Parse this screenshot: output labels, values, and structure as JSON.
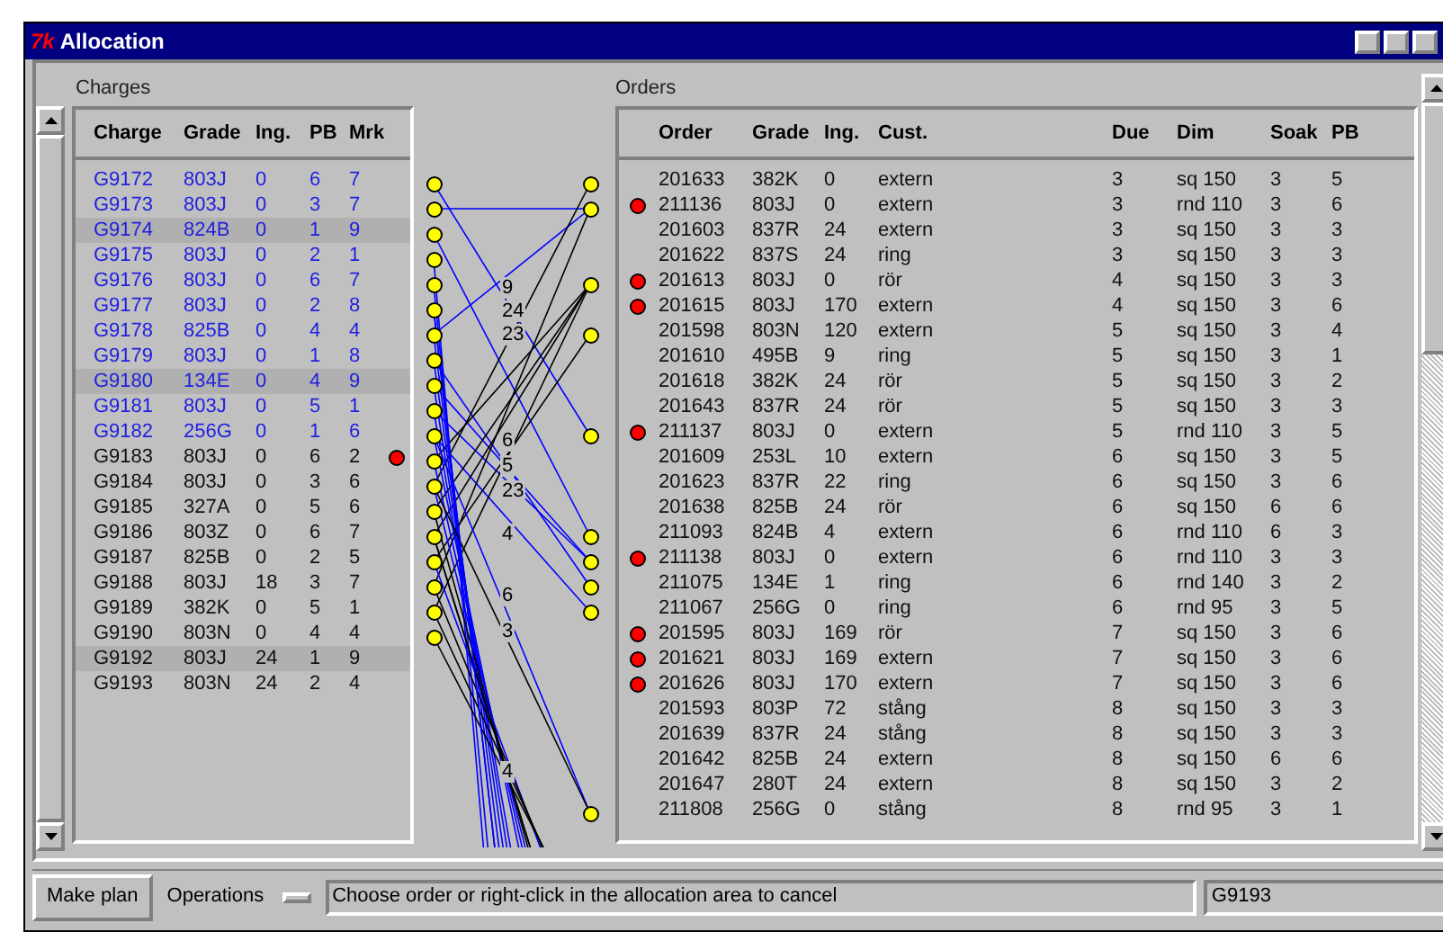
{
  "window": {
    "title": "Allocation",
    "logo": "7k"
  },
  "charges": {
    "title": "Charges",
    "columns": [
      "Charge",
      "Grade",
      "Ing.",
      "PB",
      "Mrk"
    ],
    "rows": [
      {
        "cells": [
          "G9172",
          "803J",
          "0",
          "6",
          "7"
        ],
        "planned": true,
        "highlighted": false,
        "flagged": false,
        "allocated": true
      },
      {
        "cells": [
          "G9173",
          "803J",
          "0",
          "3",
          "7"
        ],
        "planned": true,
        "highlighted": false,
        "flagged": false,
        "allocated": true
      },
      {
        "cells": [
          "G9174",
          "824B",
          "0",
          "1",
          "9"
        ],
        "planned": true,
        "highlighted": true,
        "flagged": false,
        "allocated": true
      },
      {
        "cells": [
          "G9175",
          "803J",
          "0",
          "2",
          "1"
        ],
        "planned": true,
        "highlighted": false,
        "flagged": false,
        "allocated": true
      },
      {
        "cells": [
          "G9176",
          "803J",
          "0",
          "6",
          "7"
        ],
        "planned": true,
        "highlighted": false,
        "flagged": false,
        "allocated": true
      },
      {
        "cells": [
          "G9177",
          "803J",
          "0",
          "2",
          "8"
        ],
        "planned": true,
        "highlighted": false,
        "flagged": false,
        "allocated": true
      },
      {
        "cells": [
          "G9178",
          "825B",
          "0",
          "4",
          "4"
        ],
        "planned": true,
        "highlighted": false,
        "flagged": false,
        "allocated": true
      },
      {
        "cells": [
          "G9179",
          "803J",
          "0",
          "1",
          "8"
        ],
        "planned": true,
        "highlighted": false,
        "flagged": false,
        "allocated": true
      },
      {
        "cells": [
          "G9180",
          "134E",
          "0",
          "4",
          "9"
        ],
        "planned": true,
        "highlighted": true,
        "flagged": false,
        "allocated": true
      },
      {
        "cells": [
          "G9181",
          "803J",
          "0",
          "5",
          "1"
        ],
        "planned": true,
        "highlighted": false,
        "flagged": false,
        "allocated": true
      },
      {
        "cells": [
          "G9182",
          "256G",
          "0",
          "1",
          "6"
        ],
        "planned": true,
        "highlighted": false,
        "flagged": false,
        "allocated": true
      },
      {
        "cells": [
          "G9183",
          "803J",
          "0",
          "6",
          "2"
        ],
        "planned": false,
        "highlighted": false,
        "flagged": true,
        "allocated": true
      },
      {
        "cells": [
          "G9184",
          "803J",
          "0",
          "3",
          "6"
        ],
        "planned": false,
        "highlighted": false,
        "flagged": false,
        "allocated": true
      },
      {
        "cells": [
          "G9185",
          "327A",
          "0",
          "5",
          "6"
        ],
        "planned": false,
        "highlighted": false,
        "flagged": false,
        "allocated": true
      },
      {
        "cells": [
          "G9186",
          "803Z",
          "0",
          "6",
          "7"
        ],
        "planned": false,
        "highlighted": false,
        "flagged": false,
        "allocated": true
      },
      {
        "cells": [
          "G9187",
          "825B",
          "0",
          "2",
          "5"
        ],
        "planned": false,
        "highlighted": false,
        "flagged": false,
        "allocated": true
      },
      {
        "cells": [
          "G9188",
          "803J",
          "18",
          "3",
          "7"
        ],
        "planned": false,
        "highlighted": false,
        "flagged": false,
        "allocated": true
      },
      {
        "cells": [
          "G9189",
          "382K",
          "0",
          "5",
          "1"
        ],
        "planned": false,
        "highlighted": false,
        "flagged": false,
        "allocated": true
      },
      {
        "cells": [
          "G9190",
          "803N",
          "0",
          "4",
          "4"
        ],
        "planned": false,
        "highlighted": false,
        "flagged": false,
        "allocated": true
      },
      {
        "cells": [
          "G9192",
          "803J",
          "24",
          "1",
          "9"
        ],
        "planned": false,
        "highlighted": true,
        "flagged": false,
        "allocated": false
      },
      {
        "cells": [
          "G9193",
          "803N",
          "24",
          "2",
          "4"
        ],
        "planned": false,
        "highlighted": false,
        "flagged": false,
        "allocated": false
      }
    ]
  },
  "allocation_area": {
    "labels": [
      "9",
      "24",
      "23",
      "6",
      "5",
      "23",
      "4",
      "6",
      "3",
      "4"
    ]
  },
  "orders": {
    "title": "Orders",
    "columns": [
      "Order",
      "Grade",
      "Ing.",
      "Cust.",
      "Due",
      "Dim",
      "Soak",
      "PB"
    ],
    "rows": [
      {
        "cells": [
          "201633",
          "382K",
          "0",
          "extern",
          "3",
          "sq 150",
          "3",
          "5"
        ],
        "flagged": false,
        "allocated": true
      },
      {
        "cells": [
          "211136",
          "803J",
          "0",
          "extern",
          "3",
          "rnd 110",
          "3",
          "6"
        ],
        "flagged": true,
        "allocated": true
      },
      {
        "cells": [
          "201603",
          "837R",
          "24",
          "extern",
          "3",
          "sq 150",
          "3",
          "3"
        ],
        "flagged": false,
        "allocated": false
      },
      {
        "cells": [
          "201622",
          "837S",
          "24",
          "ring",
          "3",
          "sq 150",
          "3",
          "3"
        ],
        "flagged": false,
        "allocated": false
      },
      {
        "cells": [
          "201613",
          "803J",
          "0",
          "rör",
          "4",
          "sq 150",
          "3",
          "3"
        ],
        "flagged": true,
        "allocated": true
      },
      {
        "cells": [
          "201615",
          "803J",
          "170",
          "extern",
          "4",
          "sq 150",
          "3",
          "6"
        ],
        "flagged": true,
        "allocated": false
      },
      {
        "cells": [
          "201598",
          "803N",
          "120",
          "extern",
          "5",
          "sq 150",
          "3",
          "4"
        ],
        "flagged": false,
        "allocated": true
      },
      {
        "cells": [
          "201610",
          "495B",
          "9",
          "ring",
          "5",
          "sq 150",
          "3",
          "1"
        ],
        "flagged": false,
        "allocated": false
      },
      {
        "cells": [
          "201618",
          "382K",
          "24",
          "rör",
          "5",
          "sq 150",
          "3",
          "2"
        ],
        "flagged": false,
        "allocated": false
      },
      {
        "cells": [
          "201643",
          "837R",
          "24",
          "rör",
          "5",
          "sq 150",
          "3",
          "3"
        ],
        "flagged": false,
        "allocated": false
      },
      {
        "cells": [
          "211137",
          "803J",
          "0",
          "extern",
          "5",
          "rnd 110",
          "3",
          "5"
        ],
        "flagged": true,
        "allocated": true
      },
      {
        "cells": [
          "201609",
          "253L",
          "10",
          "extern",
          "6",
          "sq 150",
          "3",
          "5"
        ],
        "flagged": false,
        "allocated": false
      },
      {
        "cells": [
          "201623",
          "837R",
          "22",
          "ring",
          "6",
          "sq 150",
          "3",
          "6"
        ],
        "flagged": false,
        "allocated": false
      },
      {
        "cells": [
          "201638",
          "825B",
          "24",
          "rör",
          "6",
          "sq 150",
          "6",
          "6"
        ],
        "flagged": false,
        "allocated": false
      },
      {
        "cells": [
          "211093",
          "824B",
          "4",
          "extern",
          "6",
          "rnd 110",
          "6",
          "3"
        ],
        "flagged": false,
        "allocated": true
      },
      {
        "cells": [
          "211138",
          "803J",
          "0",
          "extern",
          "6",
          "rnd 110",
          "3",
          "3"
        ],
        "flagged": true,
        "allocated": true
      },
      {
        "cells": [
          "211075",
          "134E",
          "1",
          "ring",
          "6",
          "rnd 140",
          "3",
          "2"
        ],
        "flagged": false,
        "allocated": true
      },
      {
        "cells": [
          "211067",
          "256G",
          "0",
          "ring",
          "6",
          "rnd 95",
          "3",
          "5"
        ],
        "flagged": false,
        "allocated": true
      },
      {
        "cells": [
          "201595",
          "803J",
          "169",
          "rör",
          "7",
          "sq 150",
          "3",
          "6"
        ],
        "flagged": true,
        "allocated": false
      },
      {
        "cells": [
          "201621",
          "803J",
          "169",
          "extern",
          "7",
          "sq 150",
          "3",
          "6"
        ],
        "flagged": true,
        "allocated": false
      },
      {
        "cells": [
          "201626",
          "803J",
          "170",
          "extern",
          "7",
          "sq 150",
          "3",
          "6"
        ],
        "flagged": true,
        "allocated": false
      },
      {
        "cells": [
          "201593",
          "803P",
          "72",
          "stång",
          "8",
          "sq 150",
          "3",
          "3"
        ],
        "flagged": false,
        "allocated": false
      },
      {
        "cells": [
          "201639",
          "837R",
          "24",
          "stång",
          "8",
          "sq 150",
          "3",
          "3"
        ],
        "flagged": false,
        "allocated": false
      },
      {
        "cells": [
          "201642",
          "825B",
          "24",
          "extern",
          "8",
          "sq 150",
          "6",
          "6"
        ],
        "flagged": false,
        "allocated": false
      },
      {
        "cells": [
          "201647",
          "280T",
          "24",
          "extern",
          "8",
          "sq 150",
          "3",
          "2"
        ],
        "flagged": false,
        "allocated": false
      },
      {
        "cells": [
          "211808",
          "256G",
          "0",
          "stång",
          "8",
          "rnd 95",
          "3",
          "1"
        ],
        "flagged": false,
        "allocated": true
      }
    ]
  },
  "toolbar": {
    "make_plan": "Make plan",
    "operations": "Operations",
    "status": "Choose order or right-click in the allocation area to cancel",
    "current": "G9193"
  }
}
